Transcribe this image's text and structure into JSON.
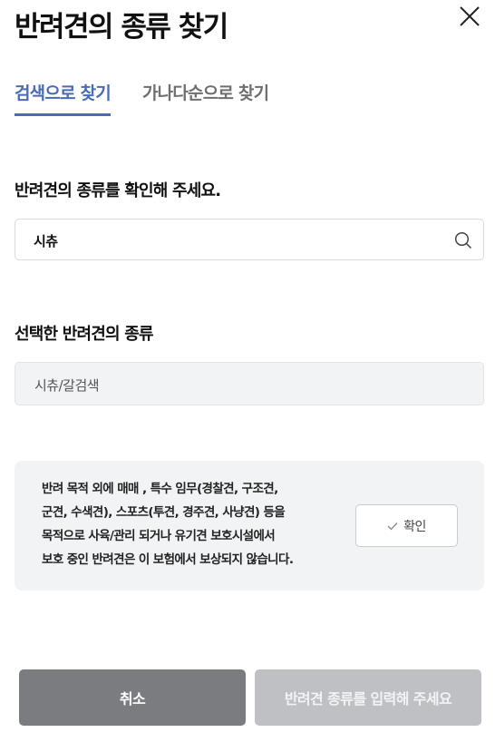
{
  "header": {
    "title": "반려견의 종류 찾기",
    "close_icon": "close-icon"
  },
  "tabs": [
    {
      "label": "검색으로 찾기",
      "active": true
    },
    {
      "label": "가나다순으로 찾기",
      "active": false
    }
  ],
  "search_section": {
    "label": "반려견의 종류를 확인해 주세요.",
    "input_value": "시츄",
    "icon": "search-icon"
  },
  "selected_section": {
    "label": "선택한 반려견의 종류",
    "value": "시츄/갈검색"
  },
  "notice": {
    "lines": [
      "반려 목적 외에 매매 , 특수 임무(경찰견, 구조견,",
      "군견, 수색견), 스포츠(투견, 경주견, 사냥견) 등을",
      "목적으로 사육/관리 되거나 유기견 보호시설에서",
      "보호 중인 반려견은 이 보험에서 보상되지 않습니다."
    ],
    "confirm_label": "확인",
    "confirm_icon": "check-icon"
  },
  "footer": {
    "cancel_label": "취소",
    "submit_label": "반려견 종류를 입력해 주세요"
  },
  "colors": {
    "accent": "#4a6bb5",
    "cancel_bg": "#7b7c80",
    "submit_disabled_bg": "#bfc0c3",
    "panel_bg": "#f2f3f5"
  }
}
